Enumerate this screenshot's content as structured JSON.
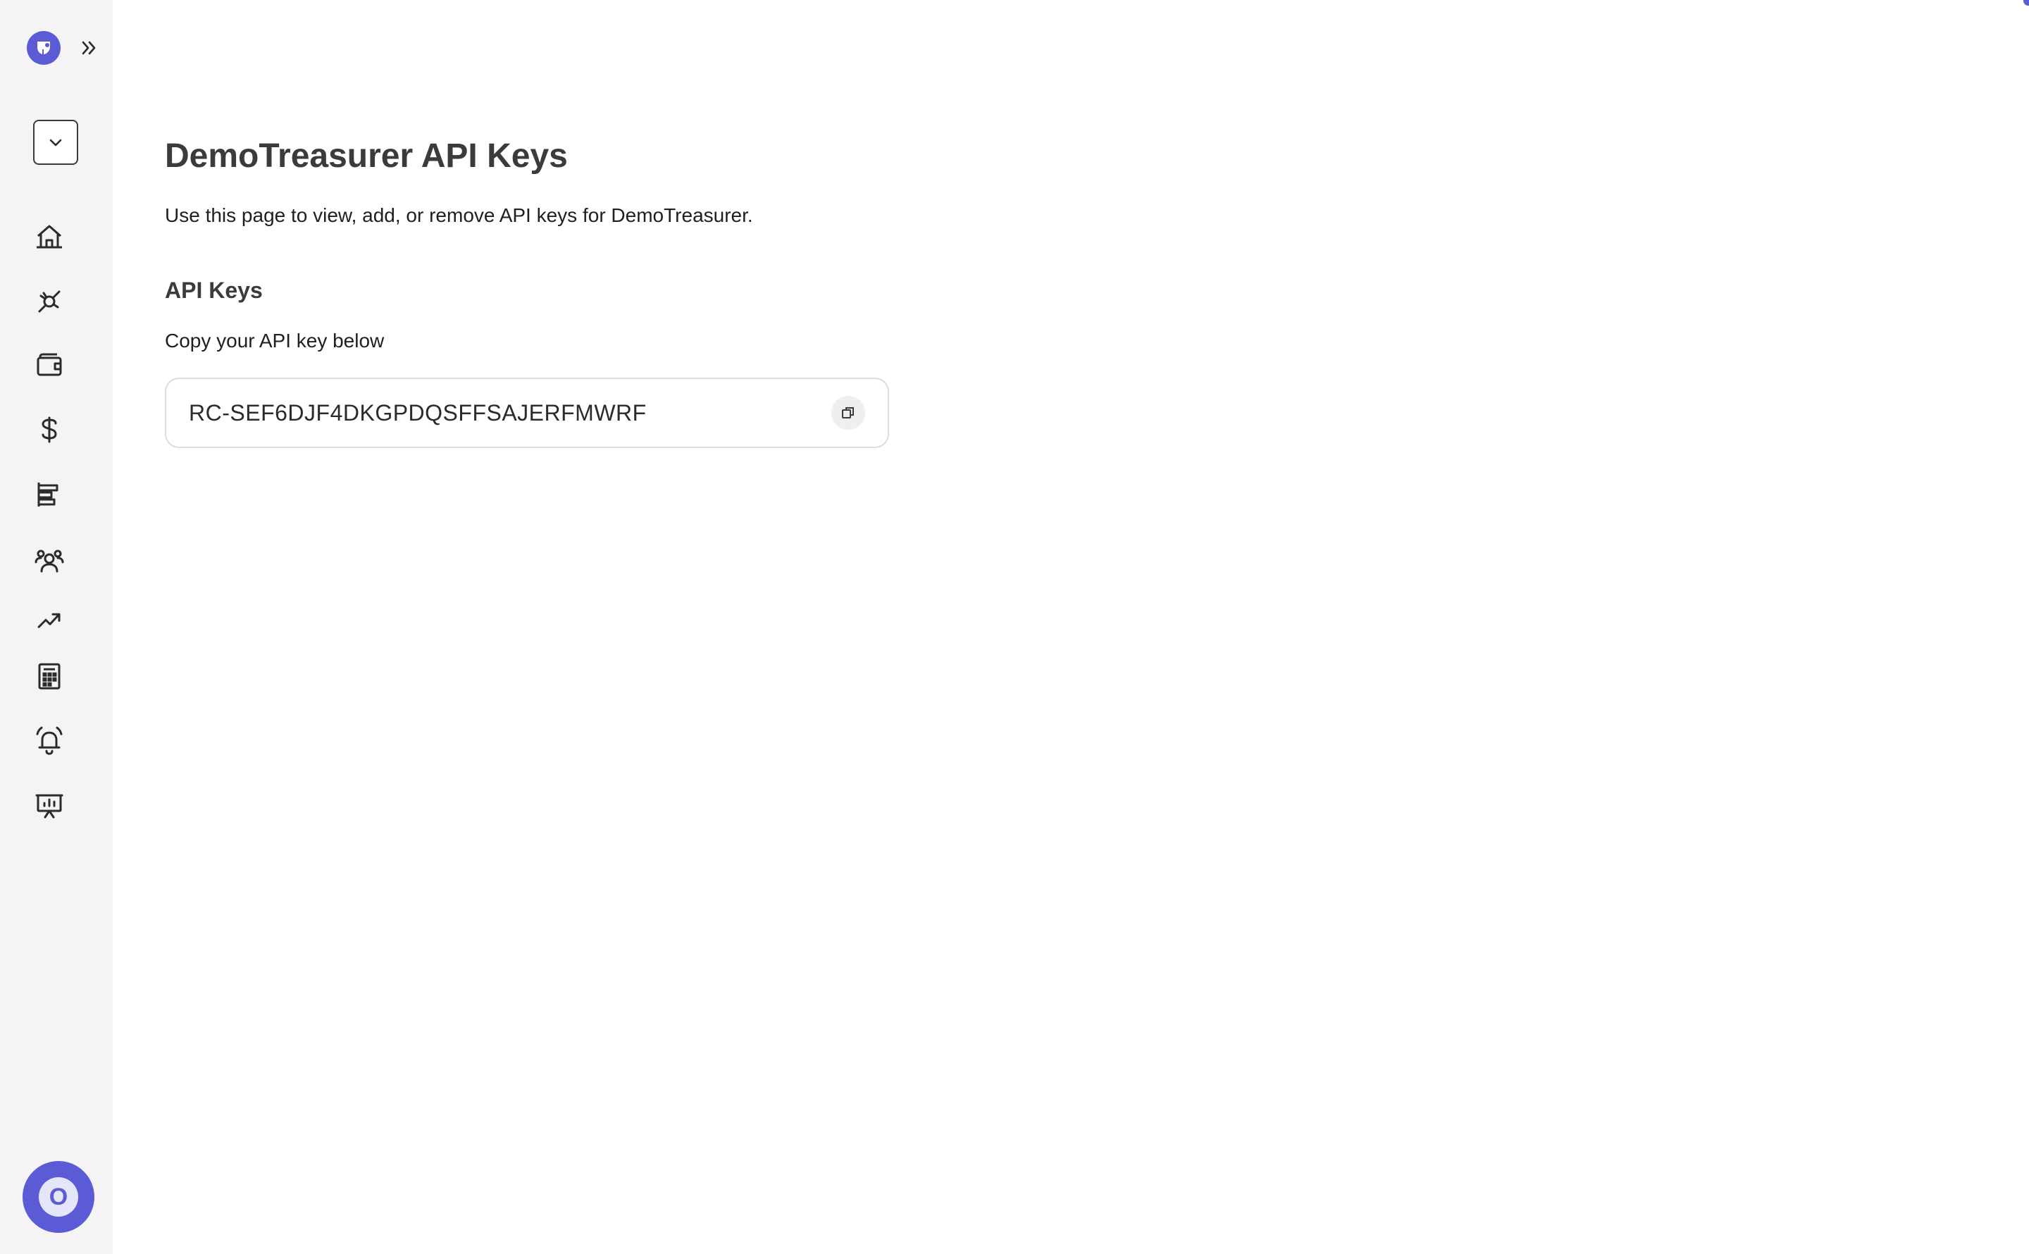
{
  "colors": {
    "accent": "#5b5bd6",
    "sidebar_bg": "#f4f4f4",
    "text_dark": "#3b3b3b"
  },
  "sidebar": {
    "logo_icon": "logo-icon",
    "expand_icon": "double-chevron-right-icon",
    "org_dropdown_icon": "chevron-down-icon",
    "items": [
      {
        "id": "home",
        "icon": "home-icon"
      },
      {
        "id": "integrations",
        "icon": "plug-icon"
      },
      {
        "id": "wallet",
        "icon": "wallet-icon"
      },
      {
        "id": "payments",
        "icon": "dollar-icon"
      },
      {
        "id": "reports",
        "icon": "bar-align-icon"
      },
      {
        "id": "customers",
        "icon": "users-icon"
      },
      {
        "id": "trends",
        "icon": "trending-up-icon"
      },
      {
        "id": "calculator",
        "icon": "calculator-icon"
      },
      {
        "id": "alerts",
        "icon": "alarm-bell-icon"
      },
      {
        "id": "presentation",
        "icon": "presentation-chart-icon"
      }
    ],
    "avatar_initial": "O"
  },
  "main": {
    "title": "DemoTreasurer API Keys",
    "description": "Use this page to view, add, or remove API keys for DemoTreasurer.",
    "section_title": "API Keys",
    "section_subtitle": "Copy your API key below",
    "api_key": "RC-SEF6DJF4DKGPDQSFFSAJERFMWRF",
    "copy_icon": "copy-icon"
  }
}
